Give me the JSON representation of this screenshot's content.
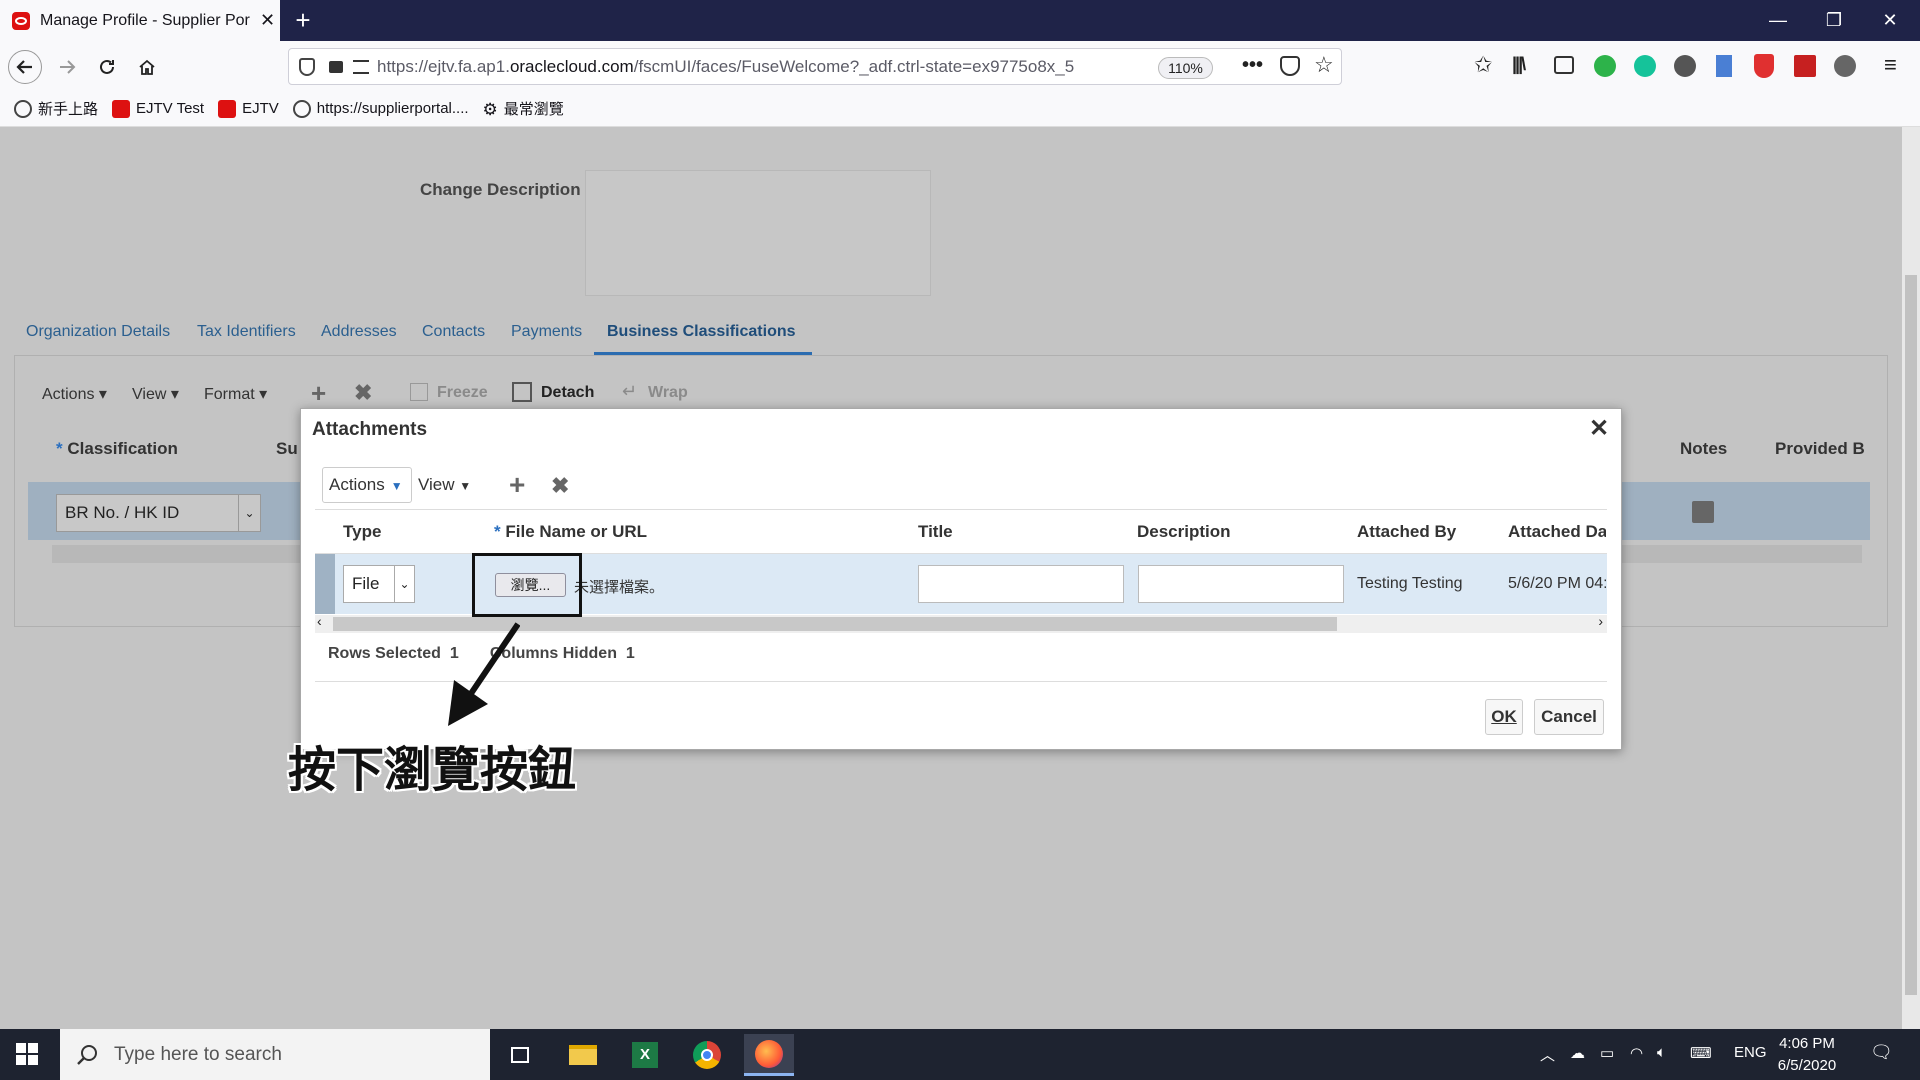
{
  "browser": {
    "tab_title": "Manage Profile - Supplier Portal",
    "url_prefix": "https://ejtv.fa.ap1.",
    "url_host": "oraclecloud.com",
    "url_path": "/fscmUI/faces/FuseWelcome?_adf.ctrl-state=ex9775o8x_5",
    "zoom": "110%",
    "bookmarks": [
      "新手上路",
      "EJTV Test",
      "EJTV",
      "https://supplierportal....",
      "最常瀏覽"
    ]
  },
  "page": {
    "change_description_label": "Change Description",
    "tabs": [
      "Organization Details",
      "Tax Identifiers",
      "Addresses",
      "Contacts",
      "Payments",
      "Business Classifications"
    ],
    "toolbar": {
      "actions": "Actions",
      "view": "View",
      "format": "Format",
      "freeze": "Freeze",
      "detach": "Detach",
      "wrap": "Wrap"
    },
    "columns": {
      "classification": "Classification",
      "sub": "Su",
      "notes": "Notes",
      "provided_by": "Provided B"
    },
    "row_value": "BR No. / HK ID"
  },
  "dialog": {
    "title": "Attachments",
    "actions": "Actions",
    "view": "View",
    "headers": {
      "type": "Type",
      "file": "File Name or URL",
      "title": "Title",
      "description": "Description",
      "attached_by": "Attached By",
      "attached_date": "Attached Da"
    },
    "row": {
      "type": "File",
      "browse": "瀏覽...",
      "no_file": "未選擇檔案。",
      "attached_by": "Testing Testing",
      "attached_date": "5/6/20 PM 04:"
    },
    "status": {
      "rows_selected_label": "Rows Selected",
      "rows_selected": "1",
      "columns_hidden_label": "Columns Hidden",
      "columns_hidden": "1"
    },
    "ok": "OK",
    "cancel": "Cancel"
  },
  "annotation": "按下瀏覽按鈕",
  "taskbar": {
    "search_placeholder": "Type here to search",
    "lang": "ENG",
    "time": "4:06 PM",
    "date": "6/5/2020"
  }
}
